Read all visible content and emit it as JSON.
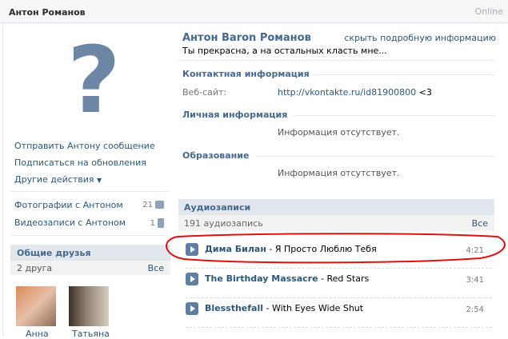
{
  "header": {
    "name": "Антон Романов",
    "status": "Online"
  },
  "left": {
    "actions": [
      "Отправить Антону сообщение",
      "Подписаться на обновления",
      "Другие действия"
    ],
    "media": [
      {
        "label": "Фотографии с Антоном",
        "count": "21",
        "icon": "camera-icon"
      },
      {
        "label": "Видеозаписи с Антоном",
        "count": "1",
        "icon": "film-icon"
      }
    ],
    "friends": {
      "title": "Общие друзья",
      "count": "2 друга",
      "all": "Все",
      "names": [
        "Анна",
        "Татьяна"
      ]
    }
  },
  "profile": {
    "name": "Антон Baron Романов",
    "hide_link": "скрыть подробную информацию",
    "status": "Ты прекрасна, а на остальных класть мне...",
    "contact_title": "Контактная информация",
    "website_label": "Веб-сайт:",
    "website": "http://vkontakte.ru/id81900800",
    "website_suffix": " <3",
    "personal_title": "Личная информация",
    "personal_value": "Информация отсутствует.",
    "education_title": "Образование",
    "education_value": "Информация отсутствует."
  },
  "audio": {
    "title": "Аудиозаписи",
    "count": "191 аудиозапись",
    "all": "Все",
    "tracks": [
      {
        "artist": "Дима Билан",
        "title": " - Я Просто Люблю Тебя",
        "duration": "4:21"
      },
      {
        "artist": "The Birthday Massacre",
        "title": " - Red Stars",
        "duration": "3:41"
      },
      {
        "artist": "Blessthefall",
        "title": " - With Eyes Wide Shut",
        "duration": "2:54"
      }
    ]
  },
  "colors": {
    "accent": "#45688e",
    "link": "#2b587a",
    "annotation": "#e01010"
  }
}
